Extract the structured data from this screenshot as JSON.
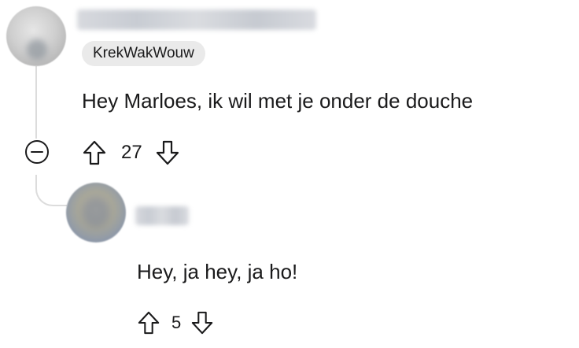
{
  "comments": [
    {
      "flair": "KrekWakWouw",
      "text": "Hey Marloes, ik wil met je onder de douche",
      "votes": "27"
    },
    {
      "text": "Hey, ja hey, ja ho!",
      "votes": "5"
    }
  ],
  "icons": {
    "collapse": "collapse-minus-icon",
    "upvote": "upvote-arrow-icon",
    "downvote": "downvote-arrow-icon"
  }
}
